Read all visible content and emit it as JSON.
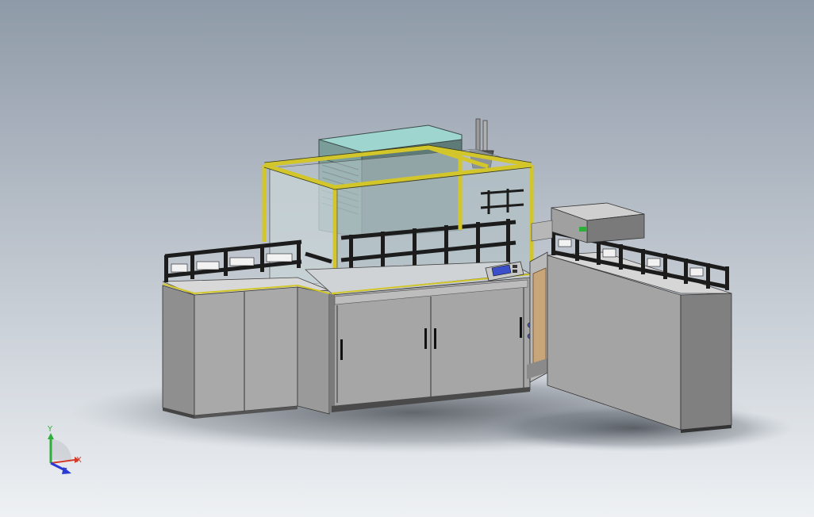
{
  "viewport": {
    "background_top": "#8f9aa8",
    "background_bottom": "#eef1f4"
  },
  "colors": {
    "frame_yellow": "#d2c62a",
    "cabinet_light": "#a9a9a9",
    "cabinet_mid": "#8f8f8f",
    "cabinet_dark": "#6e6e6e",
    "railing_black": "#1c1c1c",
    "glass": "#b9c7cc",
    "teal_box": "#9fd5cf",
    "hmi_blue": "#3b4fc9"
  },
  "triad": {
    "x_label": "X",
    "y_label": "Y",
    "z_label": "Z",
    "x_color": "#d23a2a",
    "y_color": "#2fae3a",
    "z_color": "#2a3ad2"
  }
}
